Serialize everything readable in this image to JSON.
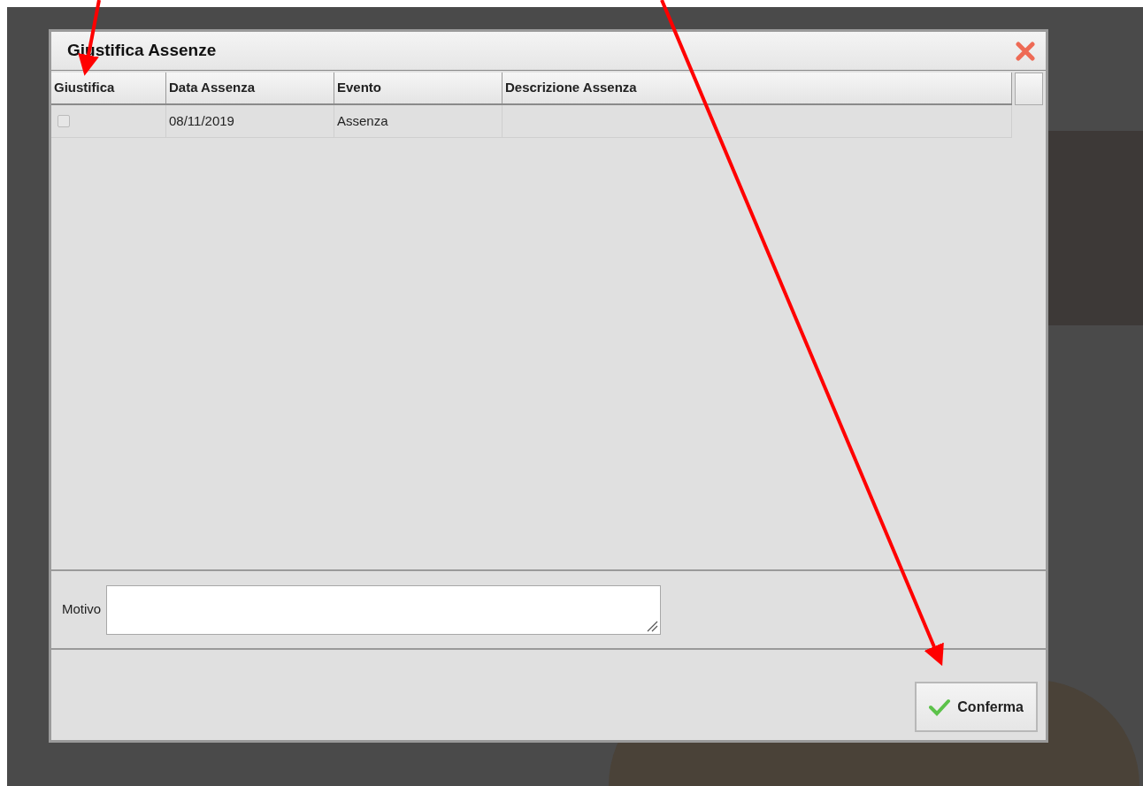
{
  "dialog": {
    "title": "Giustifica Assenze"
  },
  "table": {
    "columns": [
      "Giustifica",
      "Data Assenza",
      "Evento",
      "Descrizione Assenza"
    ],
    "rows": [
      {
        "checked": false,
        "date": "08/11/2019",
        "event": "Assenza"
      }
    ]
  },
  "motivo": {
    "label": "Motivo"
  },
  "buttons": [
    {
      "label": "Conferma"
    }
  ]
}
